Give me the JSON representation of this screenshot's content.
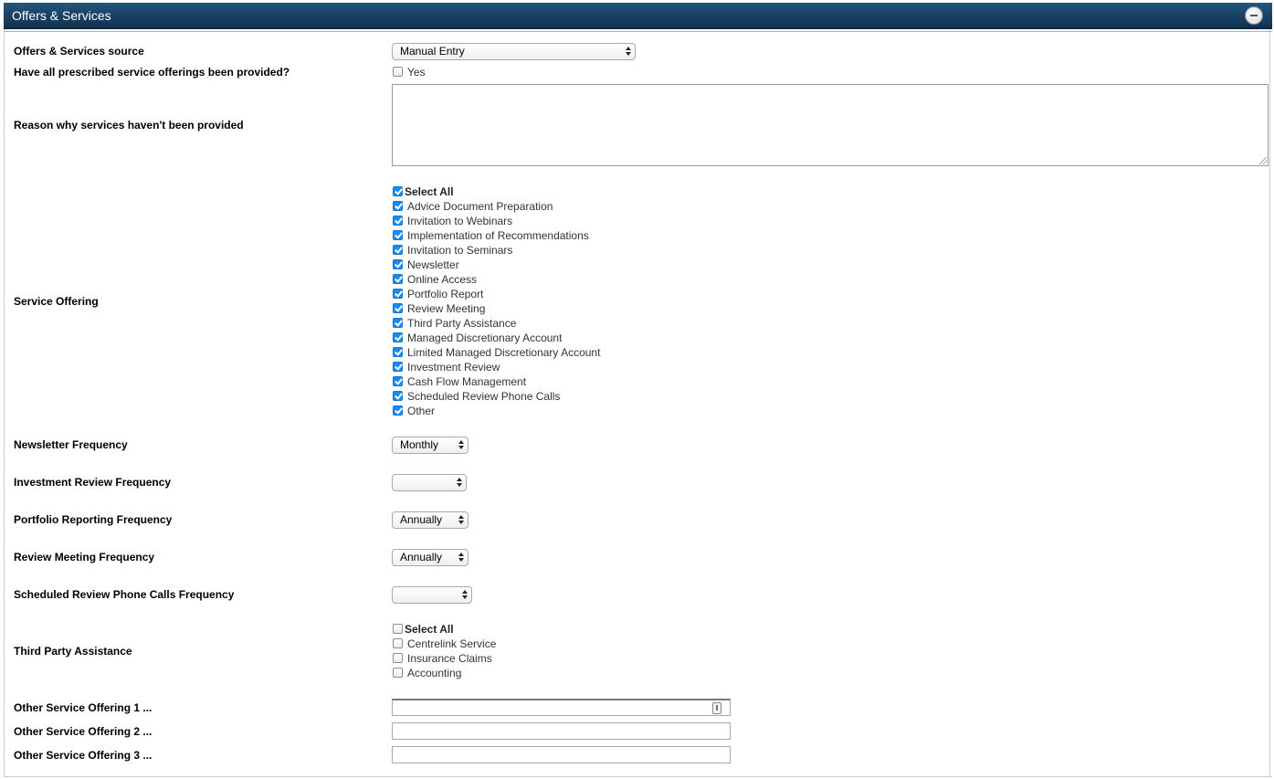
{
  "panel": {
    "title": "Offers & Services"
  },
  "fields": {
    "source": {
      "label": "Offers & Services source",
      "value": "Manual Entry"
    },
    "provided": {
      "label": "Have all prescribed service offerings been provided?",
      "option": "Yes",
      "checked": false
    },
    "reason": {
      "label": "Reason why services haven't been provided",
      "value": ""
    },
    "service_offering": {
      "label": "Service Offering",
      "select_all": "Select All",
      "options": [
        "Advice Document Preparation",
        "Invitation to Webinars",
        "Implementation of Recommendations",
        "Invitation to Seminars",
        "Newsletter",
        "Online Access",
        "Portfolio Report",
        "Review Meeting",
        "Third Party Assistance",
        "Managed Discretionary Account",
        "Limited Managed Discretionary Account",
        "Investment Review",
        "Cash Flow Management",
        "Scheduled Review Phone Calls",
        "Other"
      ],
      "all_checked": true
    },
    "newsletter_freq": {
      "label": "Newsletter Frequency",
      "value": "Monthly"
    },
    "investment_review_freq": {
      "label": "Investment Review Frequency",
      "value": ""
    },
    "portfolio_reporting_freq": {
      "label": "Portfolio Reporting Frequency",
      "value": "Annually"
    },
    "review_meeting_freq": {
      "label": "Review Meeting Frequency",
      "value": "Annually"
    },
    "phone_calls_freq": {
      "label": "Scheduled Review Phone Calls Frequency",
      "value": ""
    },
    "third_party": {
      "label": "Third Party Assistance",
      "select_all": "Select All",
      "options": [
        "Centrelink Service",
        "Insurance Claims",
        "Accounting"
      ],
      "all_checked": false
    },
    "other1": {
      "label": "Other Service Offering 1 ...",
      "value": ""
    },
    "other2": {
      "label": "Other Service Offering 2 ...",
      "value": ""
    },
    "other3": {
      "label": "Other Service Offering 3 ...",
      "value": ""
    }
  },
  "icons": {
    "collapse": "minus-circle-icon",
    "select_arrows": "updown-arrows-icon",
    "keyboard": "contact-card-icon"
  },
  "colors": {
    "header": "#1a4265",
    "checkbox_on": "#1a8bee"
  }
}
